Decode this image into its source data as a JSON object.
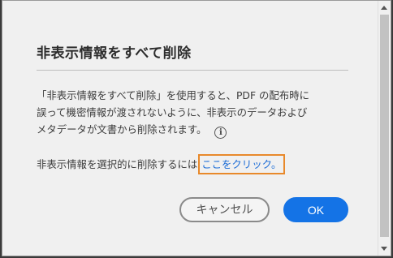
{
  "dialog": {
    "title": "非表示情報をすべて削除",
    "description_lines": [
      "「非表示情報をすべて削除」を使用すると、PDF の配布時に",
      "誤って機密情報が渡されないように、非表示のデータおよび",
      "メタデータが文書から削除されます。"
    ],
    "info_icon": "info-icon",
    "selective_text": "非表示情報を選択的に削除するには",
    "selective_link": "ここをクリック。",
    "cancel_label": "キャンセル",
    "ok_label": "OK"
  },
  "colors": {
    "accent": "#1473e6",
    "link": "#1a6bd6",
    "focus": "#e8892b",
    "background": "#f0f0f0"
  }
}
